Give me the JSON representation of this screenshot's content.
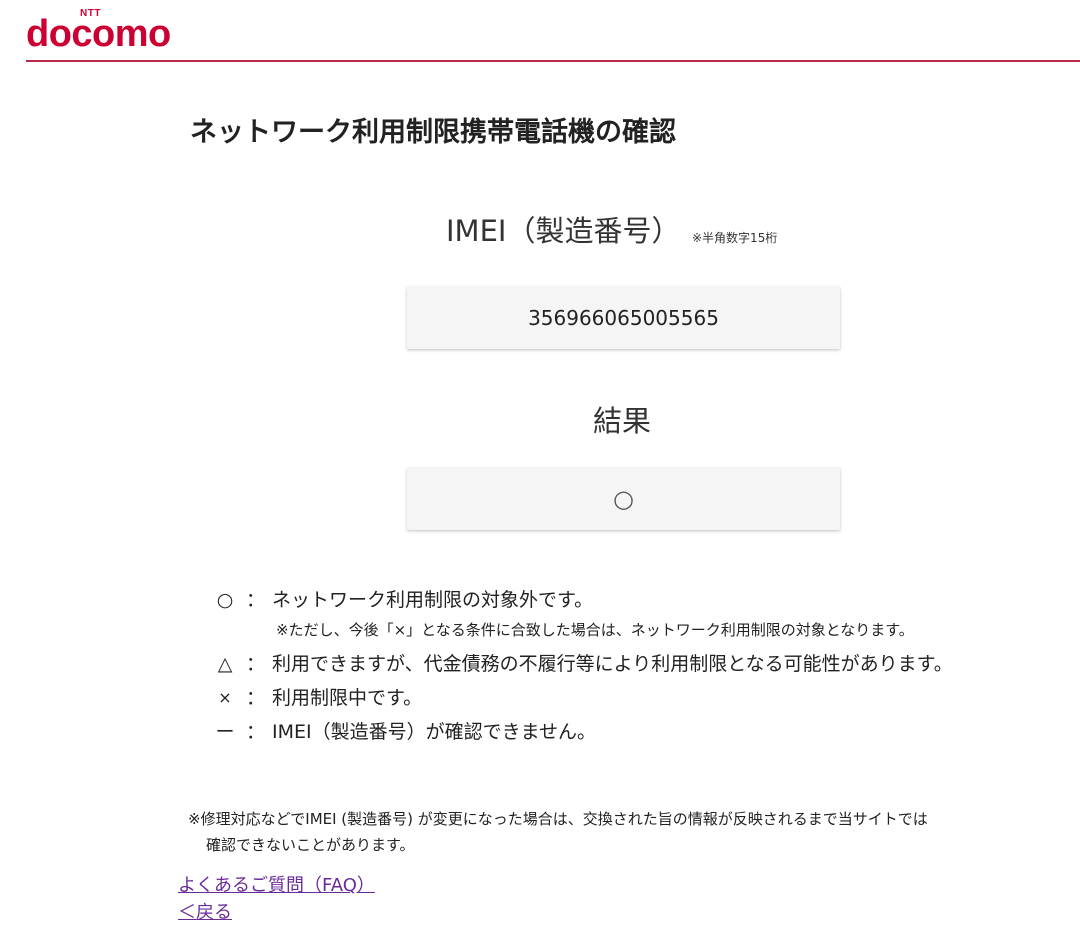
{
  "header": {
    "logo_small": "NTT",
    "logo_main": "docomo",
    "brand_color": "#cc0033"
  },
  "page_title": "ネットワーク利用制限携帯電話機の確認",
  "imei": {
    "heading": "IMEI（製造番号）",
    "note": "※半角数字15桁",
    "value": "356966065005565"
  },
  "result": {
    "heading": "結果",
    "value": "○"
  },
  "legend": [
    {
      "symbol": "○",
      "colon": "：",
      "text": "ネットワーク利用制限の対象外です。"
    },
    {
      "symbol": "△",
      "colon": "：",
      "text": "利用できますが、代金債務の不履行等により利用制限となる可能性があります。"
    },
    {
      "symbol": "×",
      "colon": "：",
      "text": "利用制限中です。"
    },
    {
      "symbol": "ー",
      "colon": "：",
      "text": "IMEI（製造番号）が確認できません。"
    }
  ],
  "legend_subnote": "※ただし、今後「×」となる条件に合致した場合は、ネットワーク利用制限の対象となります。",
  "footnote": {
    "line1": "※修理対応などでIMEI (製造番号) が変更になった場合は、交換された旨の情報が反映されるまで当サイトでは",
    "line2": "確認できないことがあります。"
  },
  "links": {
    "faq": "よくあるご質問（FAQ）",
    "back": "＜戻る"
  }
}
